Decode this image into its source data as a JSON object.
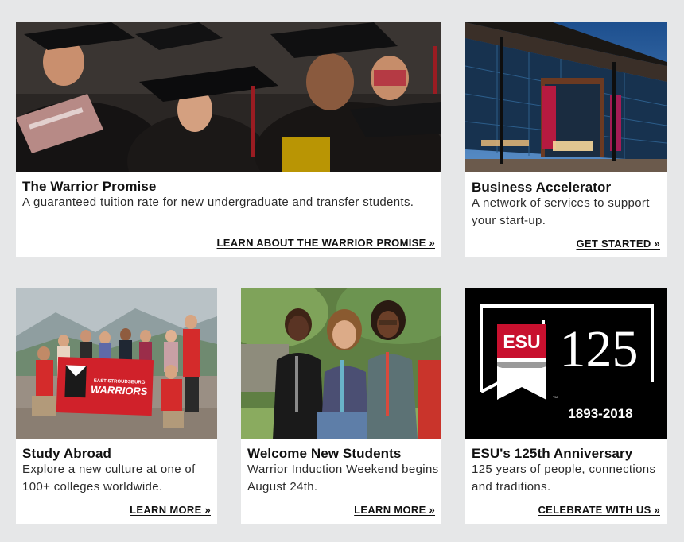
{
  "cards": [
    {
      "title": "The Warrior Promise",
      "description": "A guaranteed tuition rate for new undergraduate and transfer students.",
      "cta": "LEARN ABOUT THE WARRIOR PROMISE »",
      "image": "graduation-caps-photo"
    },
    {
      "title": "Business Accelerator",
      "description": "A network of services to support your start-up.",
      "cta": "GET STARTED »",
      "image": "business-accelerator-building-photo"
    },
    {
      "title": "Study Abroad",
      "description": "Explore a new culture at one of 100+ colleges worldwide.",
      "cta": "LEARN MORE »",
      "image": "study-abroad-group-photo",
      "banner_small": "EAST STROUDSBURG",
      "banner_large": "WARRIORS"
    },
    {
      "title": "Welcome New Students",
      "description": "Warrior Induction Weekend begins August 24th.",
      "cta": "LEARN MORE »",
      "image": "new-students-photo"
    },
    {
      "title": "ESU's 125th Anniversary",
      "description": "125 years of people, connections and traditions.",
      "cta": "CELEBRATE WITH US »",
      "image": "esu-125-logo",
      "logo_esu": "ESU",
      "logo_number": "125",
      "logo_years": "1893-2018",
      "logo_tm": "TM"
    }
  ],
  "colors": {
    "background": "#e6e7e8",
    "card": "#ffffff",
    "esu_red": "#c8102e",
    "logo_black": "#000000"
  }
}
